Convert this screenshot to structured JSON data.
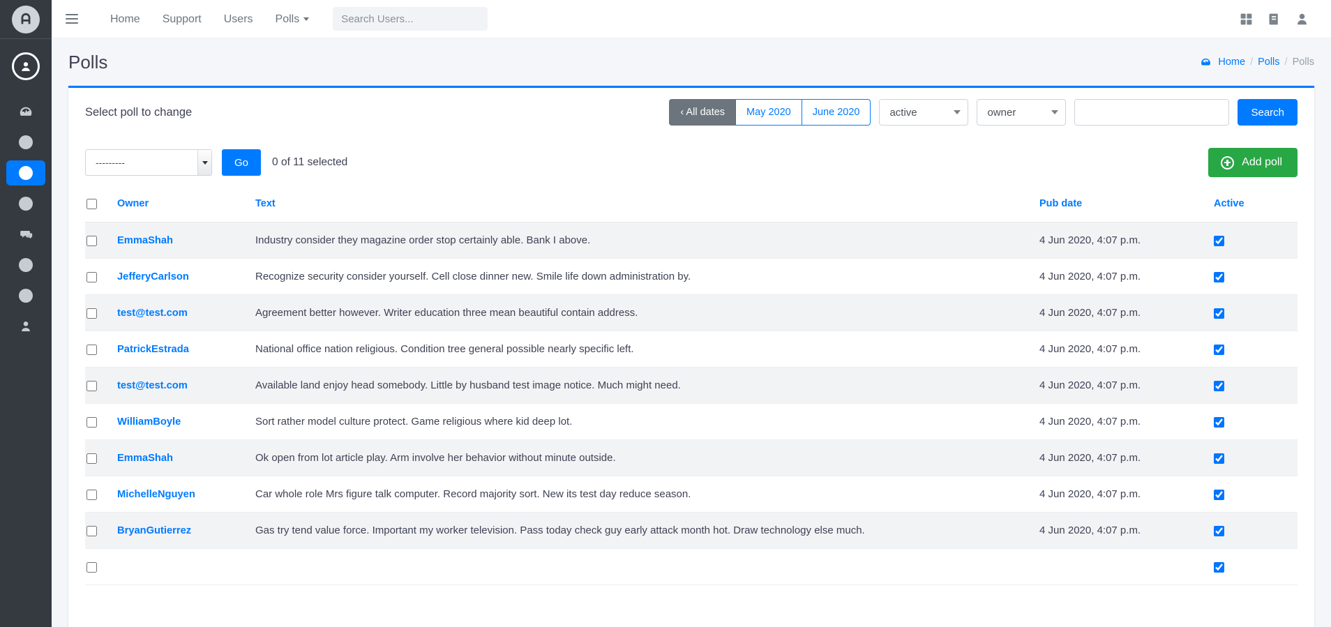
{
  "sidebar": {
    "brand": {
      "icon": "app-logo-icon",
      "glyph": "A"
    },
    "user_icon": "user-circle-icon",
    "items": [
      {
        "name": "dashboard",
        "icon": "speedometer-icon",
        "active": false
      },
      {
        "name": "item-2",
        "icon": "circle-icon",
        "active": false
      },
      {
        "name": "polls",
        "icon": "circle-icon",
        "active": true
      },
      {
        "name": "item-4",
        "icon": "circle-icon",
        "active": false
      },
      {
        "name": "messages",
        "icon": "chat-bubbles-icon",
        "active": false
      },
      {
        "name": "item-6",
        "icon": "circle-icon",
        "active": false
      },
      {
        "name": "item-7",
        "icon": "circle-icon",
        "active": false
      },
      {
        "name": "users",
        "icon": "person-icon",
        "active": false
      }
    ]
  },
  "navbar": {
    "menu_toggle_icon": "hamburger-icon",
    "links": [
      {
        "label": "Home",
        "caret": false
      },
      {
        "label": "Support",
        "caret": false
      },
      {
        "label": "Users",
        "caret": false
      },
      {
        "label": "Polls",
        "caret": true
      }
    ],
    "search": {
      "placeholder": "Search Users...",
      "value": "",
      "icon": "search-icon"
    },
    "right_icons": [
      {
        "name": "grid-icon"
      },
      {
        "name": "book-icon"
      },
      {
        "name": "user-icon"
      }
    ]
  },
  "page": {
    "title": "Polls",
    "breadcrumb": {
      "home_icon": "speedometer-icon",
      "items": [
        {
          "label": "Home",
          "current": false
        },
        {
          "label": "Polls",
          "current": false
        },
        {
          "label": "Polls",
          "current": true
        }
      ],
      "separator": "/"
    }
  },
  "toolbar": {
    "caption": "Select poll to change",
    "date_filter": {
      "options": [
        {
          "label": "‹ All dates",
          "selected": true
        },
        {
          "label": "May 2020",
          "selected": false
        },
        {
          "label": "June 2020",
          "selected": false
        }
      ]
    },
    "active_filter": {
      "value": "active"
    },
    "owner_filter": {
      "value": "owner"
    },
    "search_field": {
      "value": "",
      "placeholder": ""
    },
    "search_button": {
      "label": "Search"
    }
  },
  "actions": {
    "action_select": {
      "value": "---------"
    },
    "go_button": {
      "label": "Go"
    },
    "selected_count": "0 of 11 selected",
    "add_button": {
      "label": "Add poll",
      "icon": "plus-circle-icon",
      "color": "#28a745"
    }
  },
  "table": {
    "columns": [
      {
        "key": "select",
        "label": ""
      },
      {
        "key": "owner",
        "label": "Owner"
      },
      {
        "key": "text",
        "label": "Text"
      },
      {
        "key": "pub",
        "label": "Pub date"
      },
      {
        "key": "active",
        "label": "Active"
      }
    ],
    "rows": [
      {
        "selected": false,
        "owner": "EmmaShah",
        "text": "Industry consider they magazine order stop certainly able. Bank I above.",
        "pub": "4 Jun 2020, 4:07 p.m.",
        "active": true
      },
      {
        "selected": false,
        "owner": "JefferyCarlson",
        "text": "Recognize security consider yourself. Cell close dinner new. Smile life down administration by.",
        "pub": "4 Jun 2020, 4:07 p.m.",
        "active": true
      },
      {
        "selected": false,
        "owner": "test@test.com",
        "text": "Agreement better however. Writer education three mean beautiful contain address.",
        "pub": "4 Jun 2020, 4:07 p.m.",
        "active": true
      },
      {
        "selected": false,
        "owner": "PatrickEstrada",
        "text": "National office nation religious. Condition tree general possible nearly specific left.",
        "pub": "4 Jun 2020, 4:07 p.m.",
        "active": true
      },
      {
        "selected": false,
        "owner": "test@test.com",
        "text": "Available land enjoy head somebody. Little by husband test image notice. Much might need.",
        "pub": "4 Jun 2020, 4:07 p.m.",
        "active": true
      },
      {
        "selected": false,
        "owner": "WilliamBoyle",
        "text": "Sort rather model culture protect. Game religious where kid deep lot.",
        "pub": "4 Jun 2020, 4:07 p.m.",
        "active": true
      },
      {
        "selected": false,
        "owner": "EmmaShah",
        "text": "Ok open from lot article play. Arm involve her behavior without minute outside.",
        "pub": "4 Jun 2020, 4:07 p.m.",
        "active": true
      },
      {
        "selected": false,
        "owner": "MichelleNguyen",
        "text": "Car whole role Mrs figure talk computer. Record majority sort. New its test day reduce season.",
        "pub": "4 Jun 2020, 4:07 p.m.",
        "active": true
      },
      {
        "selected": false,
        "owner": "BryanGutierrez",
        "text": "Gas try tend value force. Important my worker television. Pass today check guy early attack month hot. Draw technology else much.",
        "pub": "4 Jun 2020, 4:07 p.m.",
        "active": true
      },
      {
        "selected": false,
        "owner": "",
        "text": "",
        "pub": "",
        "active": true
      }
    ]
  },
  "colors": {
    "accent": "#007bff",
    "sidebar_bg": "#343a40",
    "page_bg": "#f4f6f9",
    "add_green": "#28a745",
    "dark_btn": "#6c757d"
  }
}
